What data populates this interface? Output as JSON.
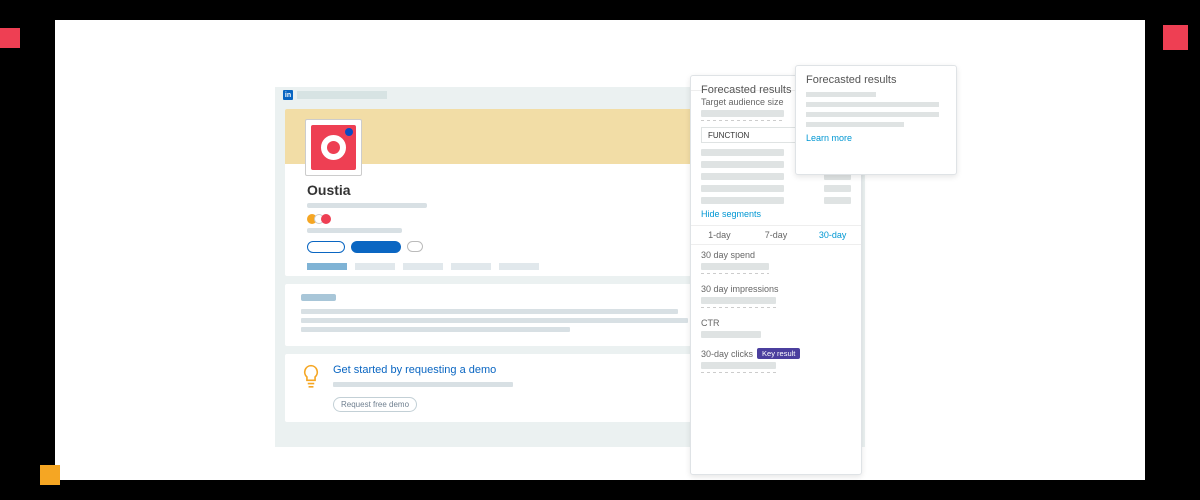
{
  "logo_text": "in",
  "profile": {
    "name": "Oustia"
  },
  "cta": {
    "title": "Get started by requesting a demo",
    "button": "Request free demo"
  },
  "panel1": {
    "header": "Forecasted results",
    "target_label": "Target audience size",
    "function_label": "FUNCTION",
    "hide_link": "Hide segments",
    "ranges": [
      "1-day",
      "7-day",
      "30-day"
    ],
    "metrics": {
      "spend": "30 day spend",
      "impressions": "30 day impressions",
      "ctr": "CTR",
      "clicks": "30-day clicks"
    },
    "key_badge": "Key result"
  },
  "panel2": {
    "header": "Forecasted results",
    "learn_link": "Learn more"
  }
}
